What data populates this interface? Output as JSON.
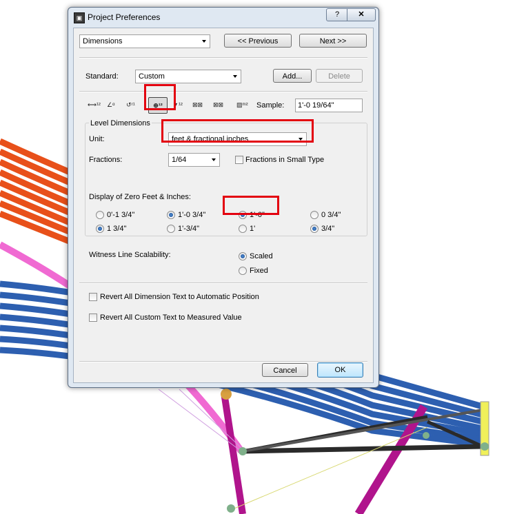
{
  "dialog": {
    "title": "Project Preferences",
    "help_glyph": "?",
    "close_glyph": "✕"
  },
  "nav": {
    "page": "Dimensions",
    "previous_label": "<< Previous",
    "next_label": "Next >>"
  },
  "standard": {
    "label": "Standard:",
    "value": "Custom",
    "add_label": "Add...",
    "delete_label": "Delete"
  },
  "toolbar": {
    "sample_label": "Sample:",
    "sample_value": "1'-0 19/64\""
  },
  "level_dimensions": {
    "group_title": "Level Dimensions",
    "unit_label": "Unit:",
    "unit_value": "feet & fractional inches",
    "fractions_label": "Fractions:",
    "fractions_value": "1/64",
    "small_type_label": "Fractions in Small Type",
    "zero_label": "Display of Zero Feet & Inches:",
    "zero_options": [
      {
        "label": "0'-1 3/4\"",
        "checked": false
      },
      {
        "label": "1'-0 3/4\"",
        "checked": true
      },
      {
        "label": "1'-0\"",
        "checked": true
      },
      {
        "label": "0 3/4\"",
        "checked": false
      },
      {
        "label": "1 3/4\"",
        "checked": true
      },
      {
        "label": "1'-3/4\"",
        "checked": false
      },
      {
        "label": "1'",
        "checked": false
      },
      {
        "label": "3/4\"",
        "checked": true
      }
    ]
  },
  "witness": {
    "label": "Witness Line Scalability:",
    "scaled_label": "Scaled",
    "fixed_label": "Fixed",
    "selected": "Scaled"
  },
  "options": {
    "revert_position_label": "Revert All Dimension Text to Automatic Position",
    "revert_custom_label": "Revert All Custom Text to Measured Value"
  },
  "footer": {
    "cancel_label": "Cancel",
    "ok_label": "OK"
  },
  "colors": {
    "highlight": "#e3000f",
    "orange_pipes": "#e8501a",
    "blue_pipes": "#2d5fb0",
    "magenta_tube": "#b0148c",
    "pink_tube": "#f06ad2",
    "black_tubes": "#2a2a2a",
    "yellow_post": "#f0f05a"
  }
}
